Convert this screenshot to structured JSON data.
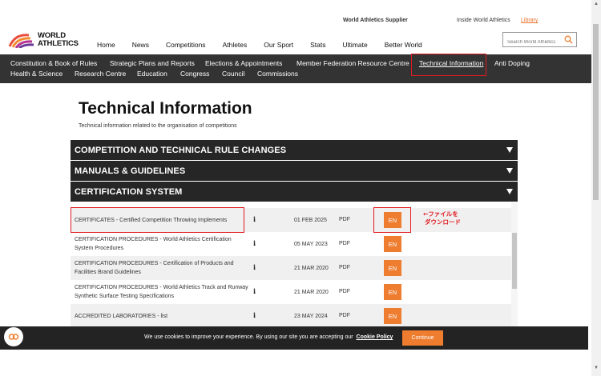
{
  "top_links": {
    "supplier": "World Athletics Supplier",
    "inside": "Inside World Athletics",
    "library": "Library"
  },
  "logo": {
    "line1": "WORLD",
    "line2": "ATHLETICS"
  },
  "main_nav": [
    "Home",
    "News",
    "Competitions",
    "Athletes",
    "Our Sport",
    "Stats",
    "Ultimate",
    "Better World"
  ],
  "search": {
    "placeholder": "Search World Athletics"
  },
  "sub_nav": [
    "Constitution & Book of Rules",
    "Strategic Plans and Reports",
    "Elections & Appointments",
    "Member Federation Resource Centre",
    "Technical Information",
    "Anti Doping",
    "Health & Science",
    "Research Centre",
    "Education",
    "Congress",
    "Council",
    "Commissions"
  ],
  "page": {
    "title": "Technical Information",
    "subtitle": "Technical information related to the organisation of competitions"
  },
  "accordions": [
    "COMPETITION AND TECHNICAL RULE CHANGES",
    "MANUALS & GUIDELINES",
    "CERTIFICATION SYSTEM"
  ],
  "documents": [
    {
      "name": "CERTIFICATES - Certified Competition Throwing Implements",
      "info": "i",
      "date": "01 FEB 2025",
      "type": "PDF",
      "lang": "EN"
    },
    {
      "name": "CERTIFICATION PROCEDURES - World Athletics Certification System Procedures",
      "info": "i",
      "date": "05 MAY 2023",
      "type": "PDF",
      "lang": "EN"
    },
    {
      "name": "CERTIFICATION PROCEDURES - Certification of Products and Facilities Brand Guidelines",
      "info": "i",
      "date": "21 MAR 2020",
      "type": "PDF",
      "lang": "EN"
    },
    {
      "name": "CERTIFICATION PROCEDURES - World Athletics Track and Runway Synthetic Surface Testing Specifications",
      "info": "i",
      "date": "21 MAR 2020",
      "type": "PDF",
      "lang": "EN"
    },
    {
      "name": "ACCREDITED LABORATORIES - list",
      "info": "i",
      "date": "23 MAY 2024",
      "type": "PDF",
      "lang": "EN"
    }
  ],
  "annotation": {
    "line1": "←ファイルを",
    "line2": "ダウンロード"
  },
  "cookie": {
    "message": "We use cookies to improve your experience. By using our site you are accepting our",
    "policy": "Cookie Policy",
    "button": "Continue"
  },
  "colors": {
    "accent": "#ef7d2f",
    "highlight": "#e01b22",
    "bar": "#262626",
    "subnav": "#333333"
  }
}
